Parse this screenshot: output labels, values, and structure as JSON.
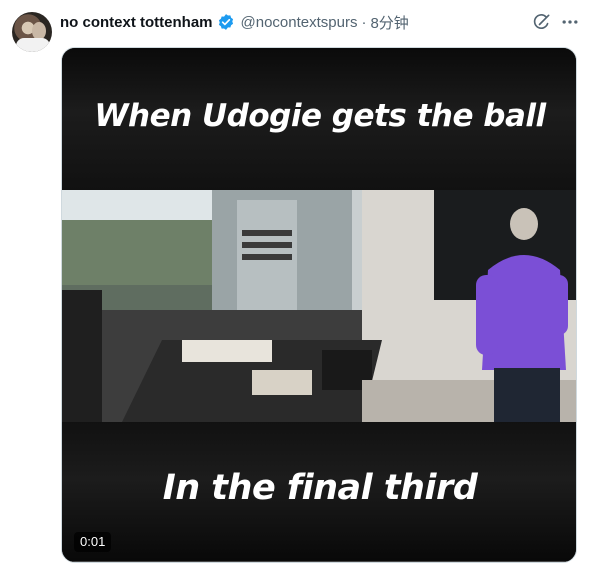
{
  "author": {
    "display_name": "no context tottenham",
    "handle": "@nocontextspurs",
    "separator": "·",
    "time": "8分钟"
  },
  "media": {
    "caption_top": "When Udogie gets the ball",
    "caption_bottom": "In the final third",
    "timestamp": "0:01",
    "progress_fraction": 0.01
  },
  "colors": {
    "verified_badge": "#1d9bf0",
    "secondary_text": "#536471",
    "shirt_purple": "#7b4fd6"
  },
  "icons": {
    "verified": "verified-badge-icon",
    "grok": "grok-icon",
    "more": "more-icon"
  }
}
